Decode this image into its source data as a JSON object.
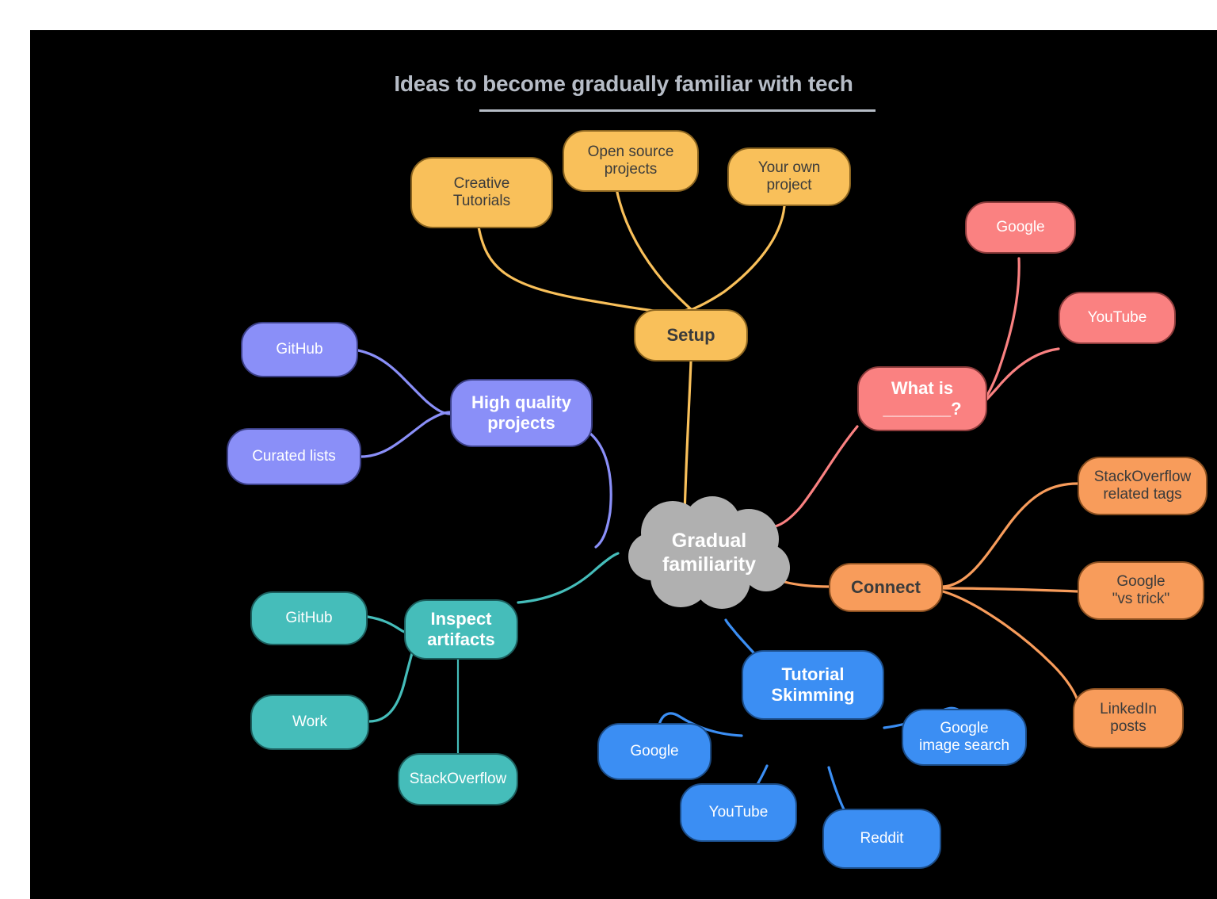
{
  "title": {
    "text": "Ideas to become gradually familiar with tech",
    "color": "#b6bcc6"
  },
  "center": {
    "label": "Gradual\nfamiliarity",
    "shape": "cloud",
    "color": "#b0b0b0",
    "text_color": "#ffffff"
  },
  "branches": [
    {
      "key": "setup",
      "label": "Setup",
      "color": "#f9c05a",
      "border": "#8a6420",
      "text_color": "#3b3b3b",
      "children": [
        {
          "label": "Creative\nTutorials"
        },
        {
          "label": "Open source\nprojects"
        },
        {
          "label": "Your own\nproject"
        }
      ]
    },
    {
      "key": "high-quality-projects",
      "label": "High quality\nprojects",
      "color": "#8a8ff8",
      "border": "#3b3f86",
      "text_color": "#ffffff",
      "children": [
        {
          "label": "GitHub"
        },
        {
          "label": "Curated lists"
        }
      ]
    },
    {
      "key": "inspect-artifacts",
      "label": "Inspect\nartifacts",
      "color": "#45bdba",
      "border": "#1c5e5d",
      "text_color": "#ffffff",
      "children": [
        {
          "label": "GitHub"
        },
        {
          "label": "Work"
        },
        {
          "label": "StackOverflow"
        }
      ]
    },
    {
      "key": "what-is",
      "label": "What is\n_______?",
      "color": "#fa8181",
      "border": "#8c3b3b",
      "text_color": "#ffffff",
      "children": [
        {
          "label": "Google"
        },
        {
          "label": "YouTube"
        }
      ]
    },
    {
      "key": "connect",
      "label": "Connect",
      "color": "#f89c5b",
      "border": "#8a4f20",
      "text_color": "#3b3b3b",
      "children": [
        {
          "label": "StackOverflow\nrelated tags"
        },
        {
          "label": "Google\n\"vs trick\""
        },
        {
          "label": "LinkedIn\nposts"
        }
      ]
    },
    {
      "key": "tutorial-skimming",
      "label": "Tutorial\nSkimming",
      "color": "#3b8ef3",
      "border": "#1b4b85",
      "text_color": "#ffffff",
      "children": [
        {
          "label": "Google"
        },
        {
          "label": "YouTube"
        },
        {
          "label": "Reddit"
        },
        {
          "label": "Google\nimage search"
        }
      ]
    }
  ],
  "nodes": {
    "creative_tutorials": "Creative\nTutorials",
    "open_source_projects": "Open source\nprojects",
    "your_own_project": "Your own\nproject",
    "setup": "Setup",
    "github_hq": "GitHub",
    "curated_lists": "Curated lists",
    "high_quality_projects": "High quality\nprojects",
    "github_inspect": "GitHub",
    "work": "Work",
    "stackoverflow_inspect": "StackOverflow",
    "inspect_artifacts": "Inspect\nartifacts",
    "google_whatis": "Google",
    "youtube_whatis": "YouTube",
    "what_is": "What is\n_______?",
    "connect": "Connect",
    "so_related_tags": "StackOverflow\nrelated tags",
    "google_vs_trick": "Google\n\"vs trick\"",
    "linkedin_posts": "LinkedIn\nposts",
    "tutorial_skimming": "Tutorial\nSkimming",
    "google_skim": "Google",
    "youtube_skim": "YouTube",
    "reddit_skim": "Reddit",
    "google_image_search": "Google\nimage search",
    "center": "Gradual\nfamiliarity"
  }
}
